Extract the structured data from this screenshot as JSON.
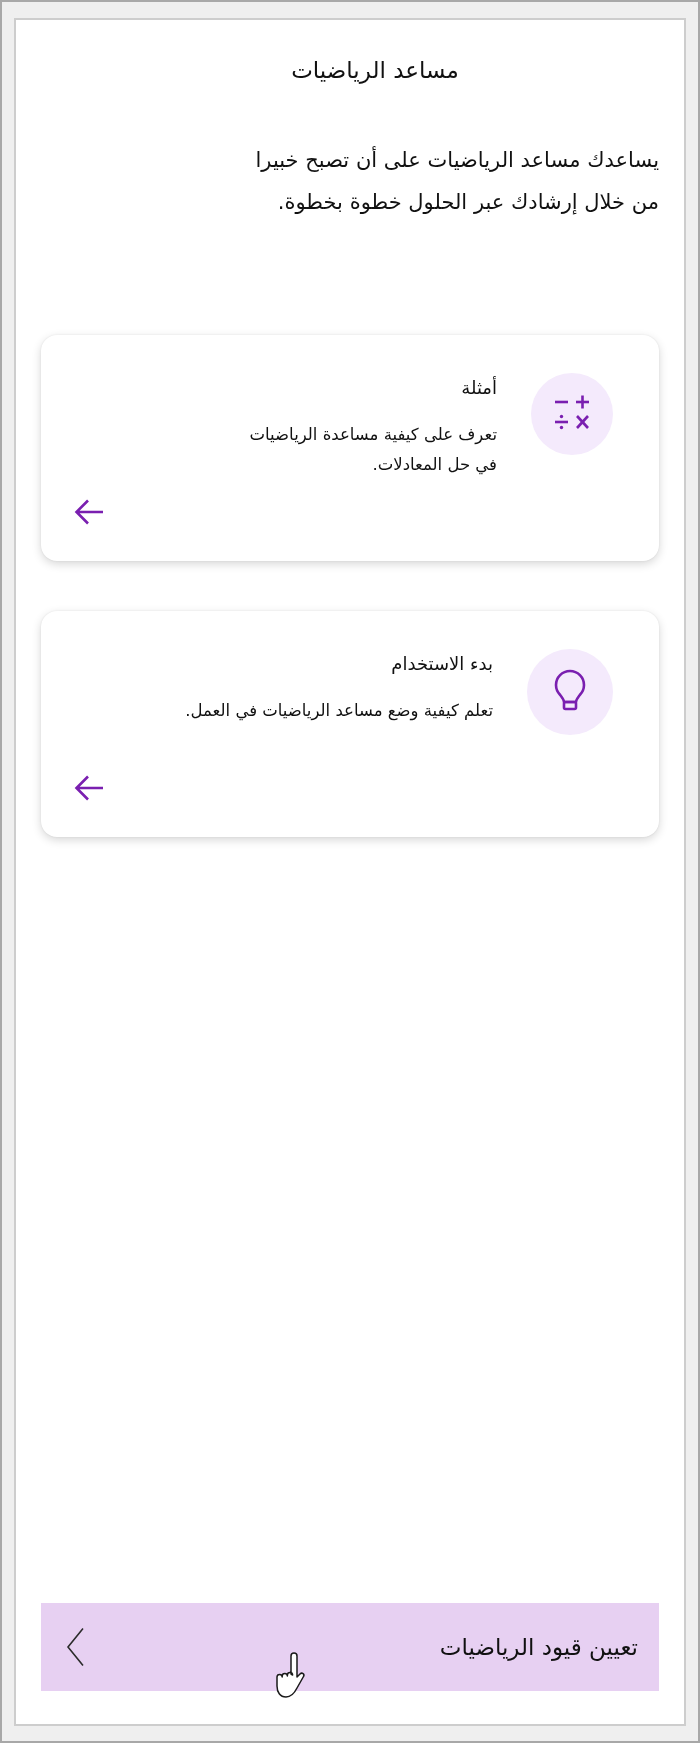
{
  "header": {
    "title": "مساعد الرياضيات"
  },
  "intro": "يساعدك مساعد الرياضيات على أن تصبح خبيرا\nمن خلال إرشادك عبر الحلول خطوة بخطوة.",
  "cards": [
    {
      "kind": "operators",
      "title": "أمثلة",
      "description": "تعرف على كيفية مساعدة الرياضيات\nفي حل المعادلات."
    },
    {
      "kind": "bulb",
      "title": "بدء الاستخدام",
      "description": "تعلم كيفية وضع مساعد الرياضيات في العمل."
    }
  ],
  "footer": {
    "label": "تعيين قيود الرياضيات"
  }
}
